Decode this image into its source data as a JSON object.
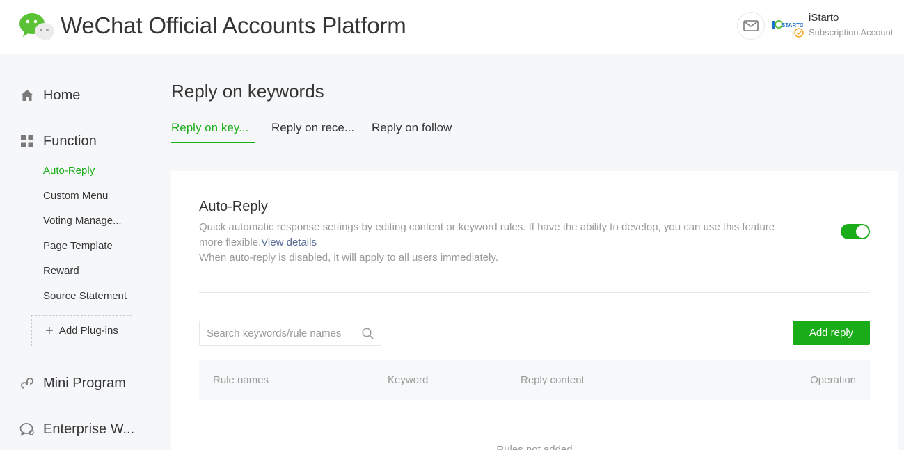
{
  "header": {
    "brand": "WeChat Official Accounts Platform",
    "account_name": "iStarto",
    "account_type": "Subscription Account",
    "account_logo_text": "STARTO",
    "colors": {
      "accent": "#1aad19"
    }
  },
  "sidebar": {
    "home": "Home",
    "function": "Function",
    "function_items": [
      {
        "label": "Auto-Reply",
        "active": true
      },
      {
        "label": "Custom Menu"
      },
      {
        "label": "Voting Manage..."
      },
      {
        "label": "Page Template"
      },
      {
        "label": "Reward"
      },
      {
        "label": "Source Statement"
      }
    ],
    "add_plugins": "Add Plug-ins",
    "mini_program": "Mini Program",
    "enterprise": "Enterprise W..."
  },
  "main": {
    "title": "Reply on keywords",
    "tabs": [
      {
        "label": "Reply on key...",
        "active": true
      },
      {
        "label": "Reply on rece..."
      },
      {
        "label": "Reply on follow"
      }
    ],
    "auto_reply": {
      "title": "Auto-Reply",
      "desc_line1": "Quick automatic response settings by editing content or keyword rules. If have the ability to develop, you can use this feature more flexible.",
      "view_details": "View details",
      "desc_line2": "When auto-reply is disabled, it will apply to all users immediately.",
      "enabled": true
    },
    "search": {
      "placeholder": "Search keywords/rule names",
      "value": ""
    },
    "add_reply": "Add reply",
    "table": {
      "columns": [
        "Rule names",
        "Keyword",
        "Reply content",
        "Operation"
      ]
    },
    "empty_text": "Rules not added"
  }
}
